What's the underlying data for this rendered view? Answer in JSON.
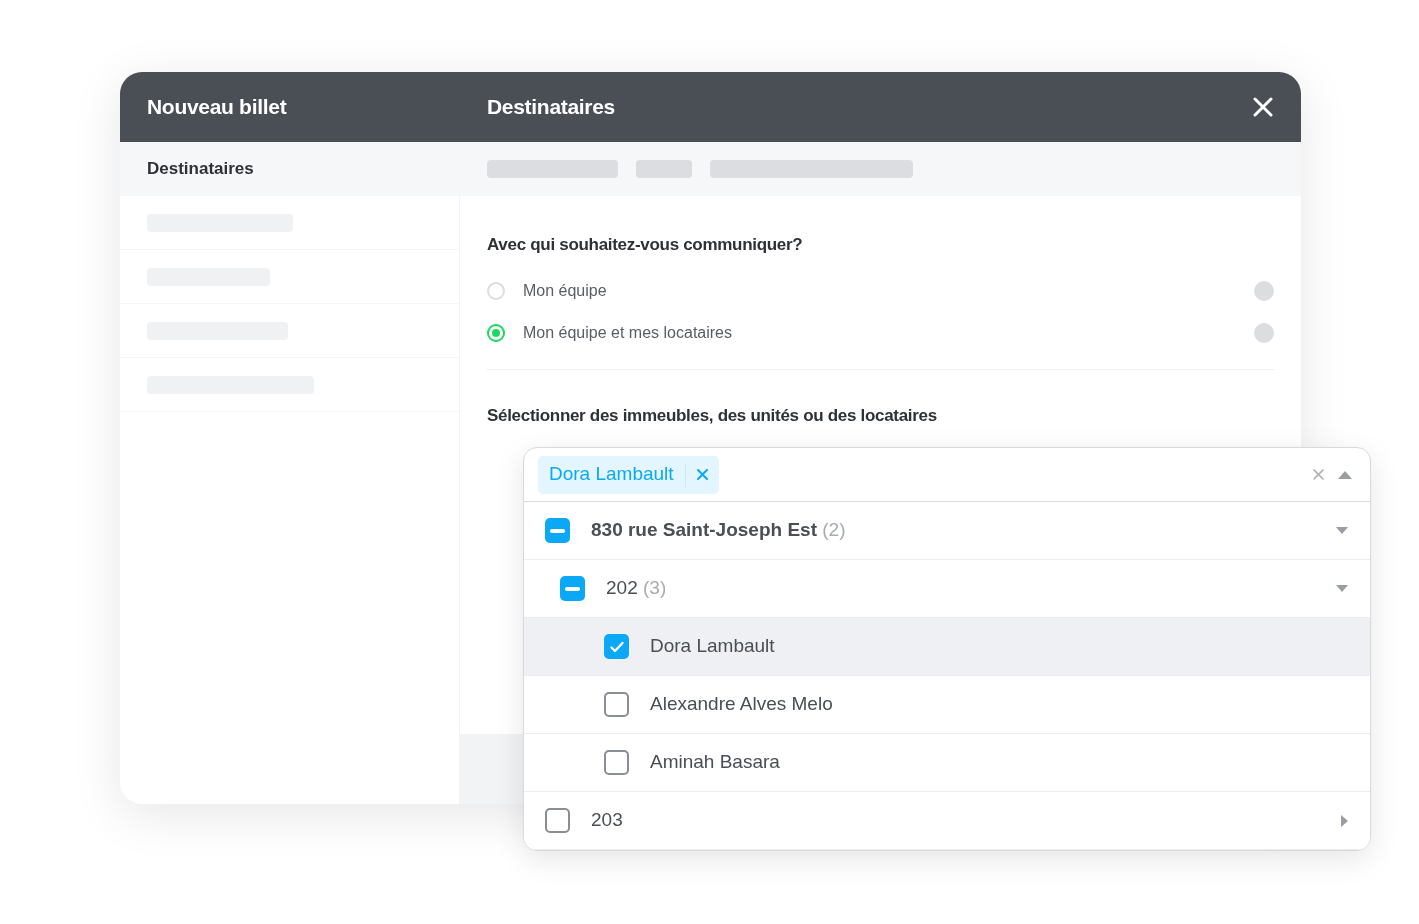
{
  "sidebar": {
    "title": "Nouveau billet",
    "section": "Destinataires"
  },
  "panel": {
    "title": "Destinataires",
    "question": "Avec qui souhaitez-vous communiquer?",
    "options": [
      {
        "label": "Mon équipe",
        "selected": false
      },
      {
        "label": "Mon équipe et mes locataires",
        "selected": true
      }
    ],
    "select_label": "Sélectionner des immeubles, des unités ou des locataires"
  },
  "picker": {
    "chips": [
      {
        "label": "Dora Lambault"
      }
    ],
    "tree": [
      {
        "label": "830 rue Saint-Joseph Est",
        "count": "(2)",
        "partial": true,
        "expanded": true,
        "children": [
          {
            "label": "202",
            "count": "(3)",
            "partial": true,
            "expanded": true,
            "children": [
              {
                "label": "Dora Lambault",
                "checked": true,
                "highlighted": true
              },
              {
                "label": "Alexandre Alves Melo",
                "checked": false,
                "highlighted": false
              },
              {
                "label": "Aminah Basara",
                "checked": false,
                "highlighted": false
              }
            ]
          }
        ]
      },
      {
        "label": "203",
        "checked": false,
        "expanded": false
      }
    ]
  }
}
